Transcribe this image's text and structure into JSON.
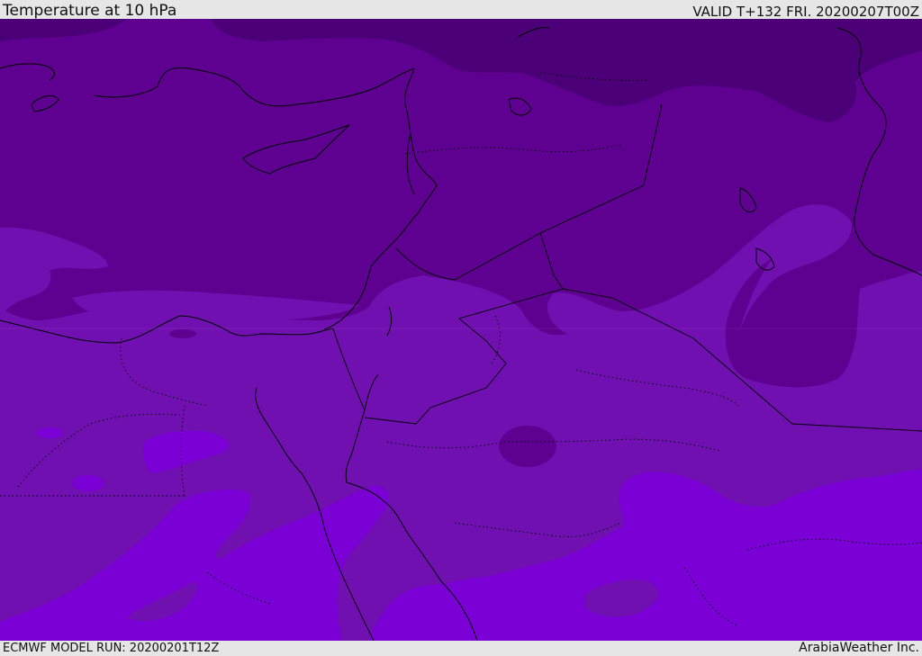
{
  "header": {
    "title": "Temperature at 10 hPa",
    "valid": "VALID T+132 FRI. 20200207T00Z"
  },
  "footer": {
    "model_run": "ECMWF MODEL RUN: 20200201T12Z",
    "credit": "ArabiaWeather Inc."
  },
  "map": {
    "colors": {
      "darkest": "#4b0078",
      "dark": "#5e0090",
      "medium": "#7010b0",
      "light": "#7a00d6",
      "coast": "#000000"
    }
  }
}
